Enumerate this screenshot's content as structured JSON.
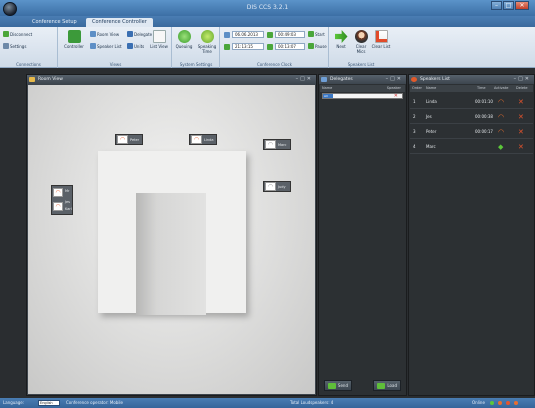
{
  "app": {
    "title": "DIS CCS 3.2.1"
  },
  "tabs": [
    "Conference Setup",
    "Conference Controller"
  ],
  "ribbon": {
    "groups": [
      {
        "label": "Connections",
        "items": [
          "Disconnect",
          "Settings"
        ]
      },
      {
        "label": "Views",
        "items": [
          "Controller",
          "Room View",
          "Speaker List",
          "Delegate",
          "Units",
          "List View"
        ]
      },
      {
        "label": "System Settings",
        "items": [
          "Queuing",
          "Speaking Time"
        ]
      },
      {
        "label": "Conference Clock",
        "items": [
          "06.06.2013",
          "00:49:03",
          "21:13:15",
          "00:13:07",
          "Start",
          "Pause"
        ]
      },
      {
        "label": "Speakers List",
        "items": [
          "Next",
          "Clear Mics",
          "Clear List"
        ]
      }
    ]
  },
  "room_panel": {
    "title": "Room View",
    "mics": [
      {
        "label": "Peter",
        "state": "active"
      },
      {
        "label": "Linda",
        "state": "active"
      },
      {
        "label": "Marc",
        "state": "idle"
      },
      {
        "label": "Judy",
        "state": "idle"
      },
      {
        "label_top": "Mr",
        "label_bottom": "Jes",
        "label_third": "Karl",
        "state": "active"
      }
    ]
  },
  "delegates_panel": {
    "title": "Delegates",
    "columns": [
      "Name",
      "Speaker"
    ],
    "filter_value": "All",
    "buttons": [
      "Send",
      "Load"
    ]
  },
  "speakers_panel": {
    "title": "Speakers List",
    "columns": [
      "Order",
      "Name",
      "Time",
      "Activate",
      "Delete"
    ],
    "rows": [
      {
        "order": "1",
        "name": "Linda",
        "time": "00:01:10",
        "signal": "orange"
      },
      {
        "order": "2",
        "name": "Jes",
        "time": "00:00:38",
        "signal": "orange"
      },
      {
        "order": "3",
        "name": "Peter",
        "time": "00:00:17",
        "signal": "orange"
      },
      {
        "order": "4",
        "name": "Marc",
        "time": "",
        "signal": "green"
      }
    ]
  },
  "statusbar": {
    "language_label": "Language:",
    "language_value": "English",
    "operator_text": "Conference operator: Mobile",
    "speakers_text": "Total Loudspeakers: 4",
    "online_label": "Online"
  },
  "colors": {
    "accent_blue": "#4a7db3",
    "wifi_orange": "#e86d2f",
    "wifi_green": "#5cc73a",
    "delete_red": "#e6542d"
  }
}
